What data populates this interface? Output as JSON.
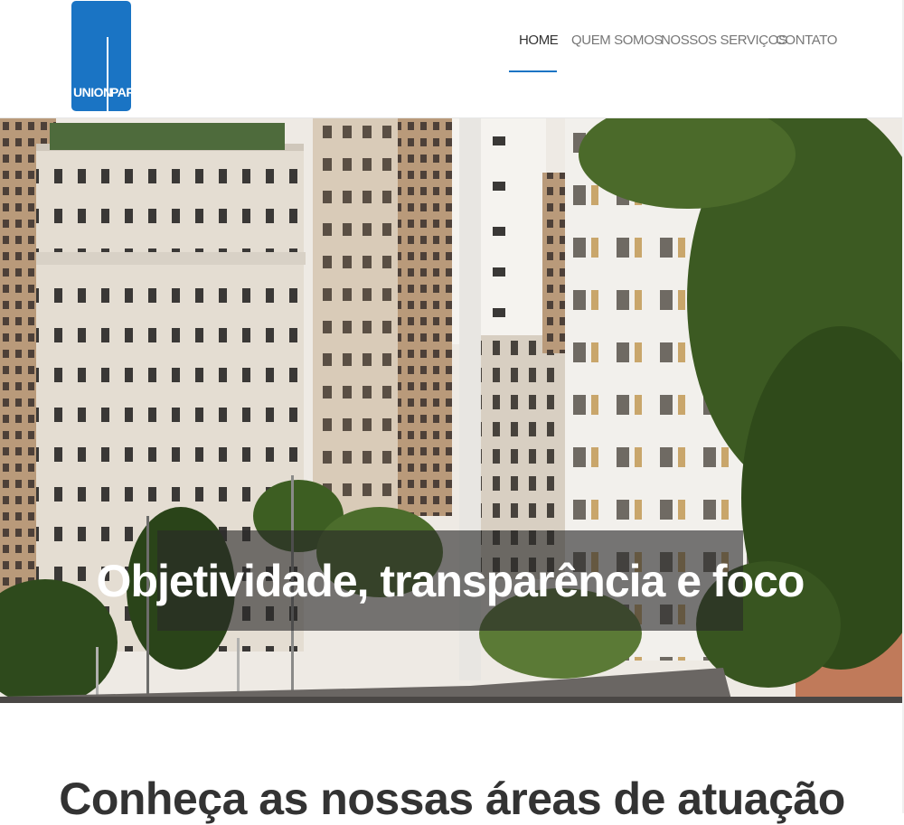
{
  "logo": {
    "left_word": "UNION",
    "right_word": "PAR",
    "brand_color": "#1a74c4"
  },
  "nav": {
    "items": [
      {
        "label": "HOME",
        "active": true
      },
      {
        "label": "QUEM SOMOS",
        "active": false
      },
      {
        "label": "NOSSOS SERVIÇOS",
        "active": false
      },
      {
        "label": "CONTATO",
        "active": false
      }
    ]
  },
  "hero": {
    "image": "city-buildings-photo",
    "caption": "Objetividade, transparência e foco"
  },
  "section": {
    "title": "Conheça as nossas áreas de atuação"
  },
  "colors": {
    "accent": "#1a74c4",
    "nav_text": "#777777",
    "nav_active": "#333333"
  }
}
